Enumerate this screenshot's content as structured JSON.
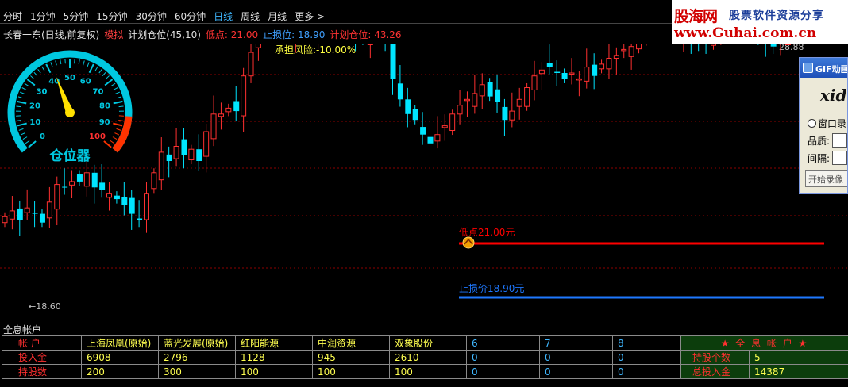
{
  "periods": {
    "tabs": [
      {
        "label": "分时"
      },
      {
        "label": "1分钟"
      },
      {
        "label": "5分钟"
      },
      {
        "label": "15分钟"
      },
      {
        "label": "30分钟"
      },
      {
        "label": "60分钟"
      },
      {
        "label": "日线",
        "active": true
      },
      {
        "label": "周线"
      },
      {
        "label": "月线"
      },
      {
        "label": "更多 >"
      }
    ]
  },
  "logo": {
    "name": "股海网",
    "slogan": "股票软件资源分享",
    "url": "www.Guhai.com.cn"
  },
  "info": {
    "title": "长春一东(日线,前复权)",
    "mode": "模拟",
    "plan": "计划仓位(45,10)",
    "low": "低点: 21.00",
    "stop": "止损位: 18.90",
    "position": "计划仓位: 43.26",
    "risk": "承担风险:-10.00%",
    "price_tag": "28.88"
  },
  "gauge": {
    "label": "仓位器",
    "ticks": [
      "0",
      "10",
      "20",
      "30",
      "40",
      "50",
      "60",
      "70",
      "80",
      "90",
      "100"
    ],
    "value": 42,
    "colors": {
      "ring": "#00c8e0",
      "red_zone": "#ff3300",
      "needle": "#ffe000"
    }
  },
  "chart_data": {
    "type": "candlestick",
    "levels": [
      {
        "label": "低点21.00元",
        "value": 21.0,
        "color": "#ff0000"
      },
      {
        "label": "止损价18.90元",
        "value": 18.9,
        "color": "#1e78ff"
      }
    ],
    "low_label": "←18.60",
    "colors": {
      "up": "#ff3030",
      "down": "#00e5ff",
      "grid": "#8b0000"
    }
  },
  "gif_recorder": {
    "title": "GIF动画",
    "brand": "xid",
    "window_option": "窗口录",
    "quality_label": "品质:",
    "interval_label": "间隔:",
    "start_button": "开始录像"
  },
  "accounts": {
    "panel_title": "全息帐户",
    "header": {
      "label": "帐  户",
      "columns": [
        "上海凤凰(原始)",
        "蓝光发展(原始)",
        "红阳能源",
        "中润资源",
        "双象股份",
        "6",
        "7",
        "8"
      ],
      "summary": "★ 全 息 帐 户 ★"
    },
    "rows": [
      {
        "label": "投入金",
        "values": [
          "6908",
          "2796",
          "1128",
          "945",
          "2610",
          "0",
          "0",
          "0"
        ],
        "summary_label": "持股个数",
        "summary_value": "5"
      },
      {
        "label": "持股数",
        "values": [
          "200",
          "300",
          "100",
          "100",
          "100",
          "0",
          "0",
          "0"
        ],
        "summary_label": "总投入金",
        "summary_value": "14387"
      }
    ]
  }
}
